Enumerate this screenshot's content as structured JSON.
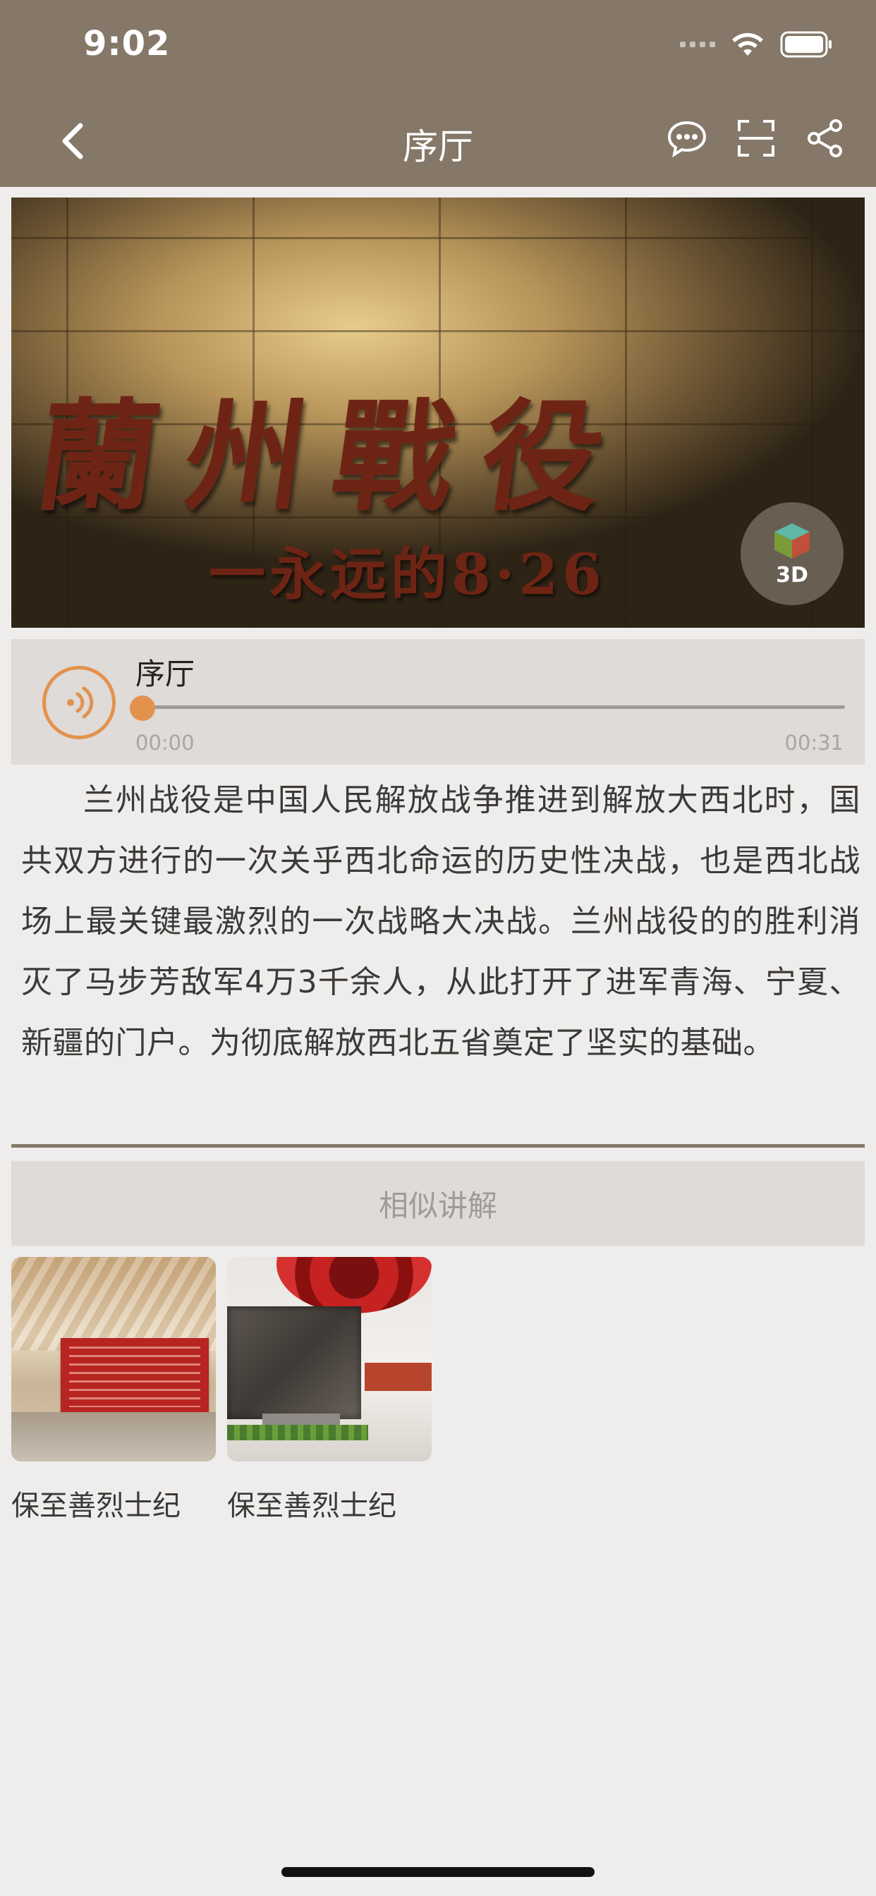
{
  "status_bar": {
    "time": "9:02"
  },
  "nav": {
    "title": "序厅",
    "back_icon": "chevron-left-icon",
    "actions": [
      "comment-icon",
      "scan-icon",
      "share-icon"
    ]
  },
  "hero": {
    "calligraphy": "蘭州戰役",
    "subtitle": "一永远的8·26",
    "badge_label": "3D"
  },
  "player": {
    "title": "序厅",
    "time_current": "00:00",
    "time_total": "00:31",
    "progress": 0,
    "accent_color": "#e3924e"
  },
  "description": "兰州战役是中国人民解放战争推进到解放大西北时，国共双方进行的一次关乎西北命运的历史性决战，也是西北战场上最关键最激烈的一次战略大决战。兰州战役的的胜利消灭了马步芳敌军4万3千余人，从此打开了进军青海、宁夏、新疆的门户。为彻底解放西北五省奠定了坚实的基础。",
  "similar": {
    "header": "相似讲解",
    "items": [
      {
        "caption": "保至善烈士纪"
      },
      {
        "caption": "保至善烈士纪"
      }
    ]
  },
  "colors": {
    "header_bg": "#857868",
    "page_bg": "#eeedec",
    "panel_bg": "#dedbd8"
  }
}
